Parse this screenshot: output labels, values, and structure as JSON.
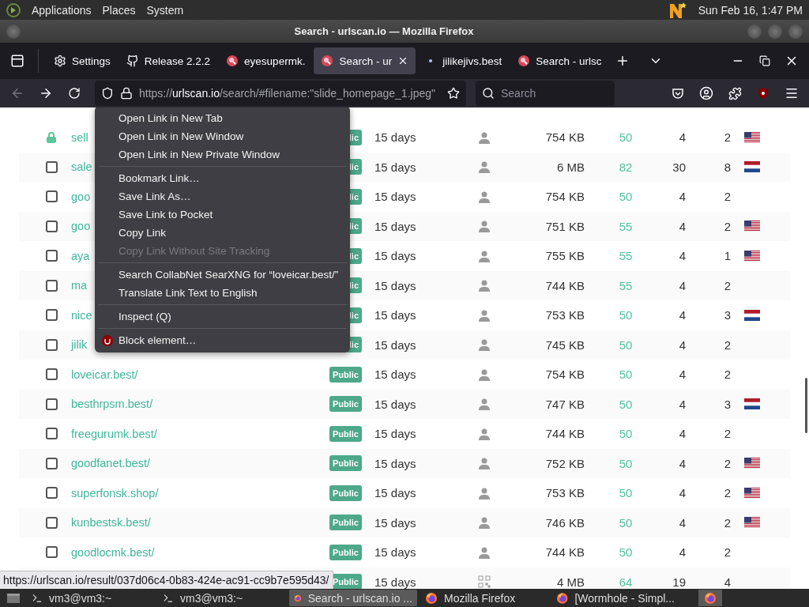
{
  "top_panel": {
    "menus": [
      "Applications",
      "Places",
      "System"
    ],
    "clock": "Sun Feb 16, 1:47 PM"
  },
  "window": {
    "title": "Search - urlscan.io — Mozilla Firefox"
  },
  "tabs": [
    {
      "label": "Settings",
      "kind": "settings",
      "selected": false
    },
    {
      "label": "Release 2.2.2",
      "kind": "github",
      "selected": false
    },
    {
      "label": "eyesupermk.",
      "kind": "site",
      "selected": false
    },
    {
      "label": "Search - ur",
      "kind": "site",
      "selected": true
    },
    {
      "label": "jilikejivs.best",
      "kind": "blank",
      "selected": false
    },
    {
      "label": "Search - urlsc",
      "kind": "site",
      "selected": false
    }
  ],
  "address_bar": {
    "prefix": "https://",
    "host": "urlscan.io",
    "path": "/search/#filename:\"slide_homepage_1.jpeg\""
  },
  "search": {
    "placeholder": "Search"
  },
  "rows": [
    {
      "kind": "lock",
      "checked": false,
      "url": "sell",
      "visibility": "lic",
      "age": "15 days",
      "thumbnail": {
        "kind": "person"
      },
      "size": "754 KB",
      "column_7": "50",
      "column_8": "4",
      "column_9": "2",
      "country": {
        "kind": "us"
      }
    },
    {
      "kind": "checkbox",
      "checked": false,
      "url": "sale",
      "visibility": "lic",
      "age": "15 days",
      "thumbnail": {
        "kind": "person"
      },
      "size": "6 MB",
      "column_7": "82",
      "column_8": "30",
      "column_9": "8",
      "country": {
        "kind": "nl"
      }
    },
    {
      "kind": "checkbox",
      "checked": false,
      "url": "goo",
      "visibility": "lic",
      "age": "15 days",
      "thumbnail": {
        "kind": "person"
      },
      "size": "754 KB",
      "column_7": "50",
      "column_8": "4",
      "column_9": "2"
    },
    {
      "kind": "checkbox",
      "checked": false,
      "url": "goo",
      "visibility": "lic",
      "age": "15 days",
      "thumbnail": {
        "kind": "person"
      },
      "size": "751 KB",
      "column_7": "55",
      "column_8": "4",
      "column_9": "2",
      "country": {
        "kind": "us"
      }
    },
    {
      "kind": "checkbox",
      "checked": false,
      "url": "aya",
      "visibility": "lic",
      "age": "15 days",
      "thumbnail": {
        "kind": "person"
      },
      "size": "755 KB",
      "column_7": "55",
      "column_8": "4",
      "column_9": "1",
      "country": {
        "kind": "us"
      }
    },
    {
      "kind": "checkbox",
      "checked": false,
      "url": "ma",
      "visibility": "lic",
      "age": "15 days",
      "thumbnail": {
        "kind": "person"
      },
      "size": "744 KB",
      "column_7": "55",
      "column_8": "4",
      "column_9": "2"
    },
    {
      "kind": "checkbox",
      "checked": false,
      "url": "nice",
      "visibility": "lic",
      "age": "15 days",
      "thumbnail": {
        "kind": "person"
      },
      "size": "753 KB",
      "column_7": "50",
      "column_8": "4",
      "column_9": "3",
      "country": {
        "kind": "nl"
      }
    },
    {
      "kind": "checkbox",
      "checked": false,
      "url": "jilik",
      "visibility": "lic",
      "age": "15 days",
      "thumbnail": {
        "kind": "person"
      },
      "size": "745 KB",
      "column_7": "50",
      "column_8": "4",
      "column_9": "2"
    },
    {
      "kind": "checkbox",
      "checked": false,
      "url": "loveicar.best/",
      "visibility": "Public",
      "age": "15 days",
      "thumbnail": {
        "kind": "person"
      },
      "size": "754 KB",
      "column_7": "50",
      "column_8": "4",
      "column_9": "2"
    },
    {
      "kind": "checkbox",
      "checked": false,
      "url": "besthrpsm.best/",
      "visibility": "Public",
      "age": "15 days",
      "thumbnail": {
        "kind": "person"
      },
      "size": "747 KB",
      "column_7": "50",
      "column_8": "4",
      "column_9": "3",
      "country": {
        "kind": "nl"
      }
    },
    {
      "kind": "checkbox",
      "checked": false,
      "url": "freegurumk.best/",
      "visibility": "Public",
      "age": "15 days",
      "thumbnail": {
        "kind": "person"
      },
      "size": "744 KB",
      "column_7": "50",
      "column_8": "4",
      "column_9": "2"
    },
    {
      "kind": "checkbox",
      "checked": false,
      "url": "goodfanet.best/",
      "visibility": "Public",
      "age": "15 days",
      "thumbnail": {
        "kind": "person"
      },
      "size": "752 KB",
      "column_7": "50",
      "column_8": "4",
      "column_9": "2",
      "country": {
        "kind": "us"
      }
    },
    {
      "kind": "checkbox",
      "checked": false,
      "url": "superfonsk.shop/",
      "visibility": "Public",
      "age": "15 days",
      "thumbnail": {
        "kind": "person"
      },
      "size": "753 KB",
      "column_7": "50",
      "column_8": "4",
      "column_9": "2",
      "country": {
        "kind": "us"
      }
    },
    {
      "kind": "checkbox",
      "checked": false,
      "url": "kunbestsk.best/",
      "visibility": "Public",
      "age": "15 days",
      "thumbnail": {
        "kind": "person"
      },
      "size": "746 KB",
      "column_7": "50",
      "column_8": "4",
      "column_9": "2",
      "country": {
        "kind": "us"
      }
    },
    {
      "kind": "checkbox",
      "checked": false,
      "url": "goodlocmk.best/",
      "visibility": "Public",
      "age": "15 days",
      "thumbnail": {
        "kind": "person"
      },
      "size": "744 KB",
      "column_7": "50",
      "column_8": "4",
      "column_9": "2"
    },
    {
      "kind": "covered",
      "visibility": "Public",
      "age": "15 days",
      "thumbnail": {
        "kind": "qr"
      },
      "size": "4 MB",
      "column_7": "64",
      "column_8": "19",
      "column_9": "4"
    }
  ],
  "context_menu": [
    {
      "kind": "item",
      "label": "Open Link in New Tab",
      "disabled": false
    },
    {
      "kind": "item",
      "label": "Open Link in New Window",
      "disabled": false
    },
    {
      "kind": "item",
      "label": "Open Link in New Private Window",
      "disabled": false
    },
    {
      "kind": "separator"
    },
    {
      "kind": "item",
      "label": "Bookmark Link…",
      "disabled": false
    },
    {
      "kind": "item",
      "label": "Save Link As…",
      "disabled": false
    },
    {
      "kind": "item",
      "label": "Save Link to Pocket",
      "disabled": false
    },
    {
      "kind": "item",
      "label": "Copy Link",
      "disabled": false
    },
    {
      "kind": "item",
      "label": "Copy Link Without Site Tracking",
      "disabled": true
    },
    {
      "kind": "separator"
    },
    {
      "kind": "item",
      "label": "Search CollabNet SearXNG for “loveicar.best/”",
      "disabled": false
    },
    {
      "kind": "item",
      "label": "Translate Link Text to English",
      "disabled": false
    },
    {
      "kind": "separator"
    },
    {
      "kind": "item",
      "label": "Inspect (Q)",
      "disabled": false
    },
    {
      "kind": "separator"
    },
    {
      "kind": "extension",
      "label": "Block element…",
      "disabled": false
    }
  ],
  "status_link": "https://urlscan.io/result/037d06c4-0b83-424e-ac91-cc9b7e595d43/",
  "taskbar": [
    {
      "label": "vm3@vm3:~",
      "kind": "terminal",
      "selected": false
    },
    {
      "label": "vm3@vm3:~",
      "kind": "terminal",
      "selected": false
    },
    {
      "label": "Search - urlscan.io ...",
      "kind": "browser",
      "selected": true
    },
    {
      "label": "Mozilla Firefox",
      "kind": "browser",
      "selected": false
    },
    {
      "label": "[Wormhole - Simpl...",
      "kind": "browser",
      "selected": false
    }
  ]
}
